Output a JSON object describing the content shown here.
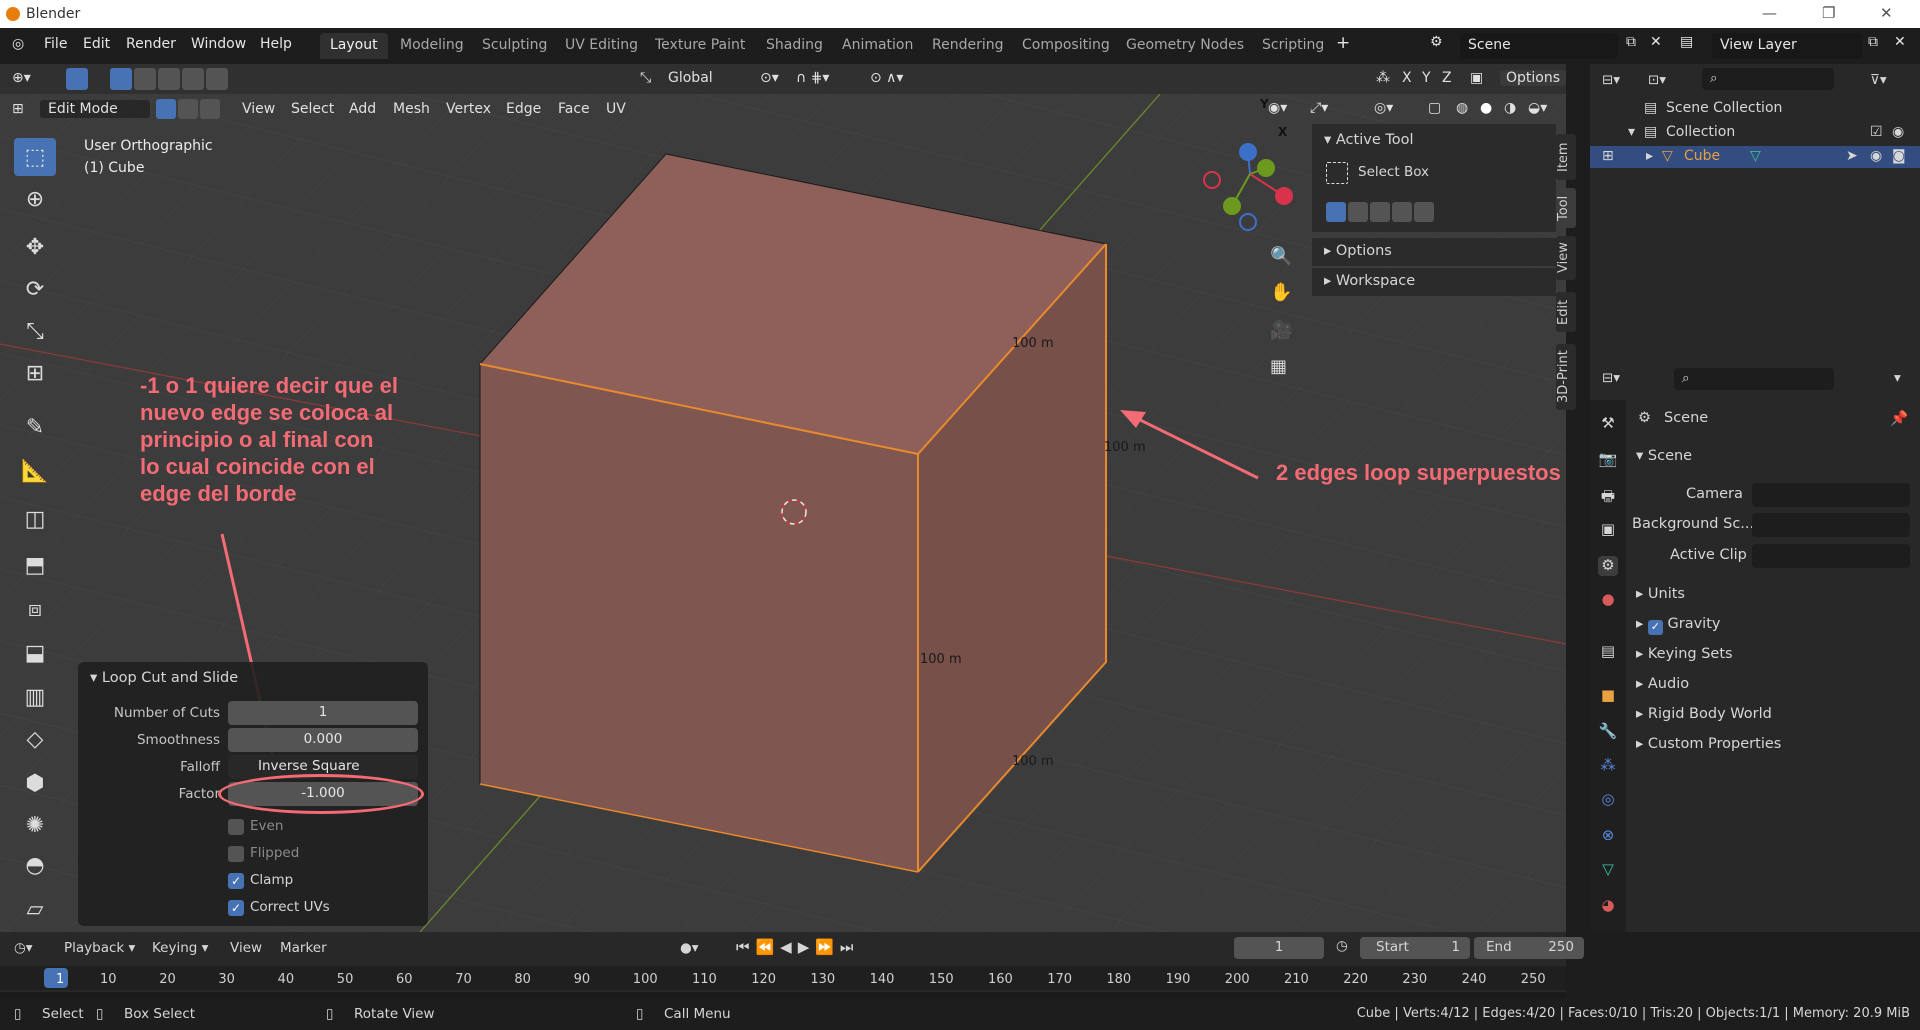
{
  "window": {
    "title": "Blender"
  },
  "menu": [
    "File",
    "Edit",
    "Render",
    "Window",
    "Help"
  ],
  "workspaces": [
    "Layout",
    "Modeling",
    "Sculpting",
    "UV Editing",
    "Texture Paint",
    "Shading",
    "Animation",
    "Rendering",
    "Compositing",
    "Geometry Nodes",
    "Scripting"
  ],
  "scene_name": "Scene",
  "view_layer": "View Layer",
  "viewport": {
    "mode": "Edit Mode",
    "menus": [
      "View",
      "Select",
      "Add",
      "Mesh",
      "Vertex",
      "Edge",
      "Face",
      "UV"
    ],
    "orientation": "Global",
    "axes": [
      "X",
      "Y",
      "Z"
    ],
    "options_label": "Options",
    "info_line1": "User Orthographic",
    "info_line2": "(1) Cube",
    "dims": [
      "100 m",
      "100 m",
      "100 m",
      "100 m"
    ],
    "gizmo": {
      "x": "X",
      "y": "Y",
      "z": "Z"
    }
  },
  "npanel": {
    "active_tool_title": "Active Tool",
    "tool_name": "Select Box",
    "options": "Options",
    "workspace": "Workspace",
    "tabs": [
      "Item",
      "Tool",
      "View",
      "Edit",
      "3D-Print"
    ]
  },
  "loop_panel": {
    "title": "Loop Cut and Slide",
    "number_of_cuts_label": "Number of Cuts",
    "number_of_cuts": "1",
    "smoothness_label": "Smoothness",
    "smoothness": "0.000",
    "falloff_label": "Falloff",
    "falloff": "Inverse Square",
    "factor_label": "Factor",
    "factor": "-1.000",
    "even": "Even",
    "flipped": "Flipped",
    "clamp": "Clamp",
    "correct_uvs": "Correct UVs"
  },
  "annotations": {
    "left_lines": [
      "-1 o 1 quiere decir que el",
      "nuevo edge se coloca al",
      "principio o al final con",
      "lo cual coincide con el",
      "edge del borde"
    ],
    "right": "2 edges loop superpuestos",
    "color": "#f36b74"
  },
  "outliner": {
    "scene_collection": "Scene Collection",
    "collection": "Collection",
    "cube": "Cube"
  },
  "properties": {
    "header": "Scene",
    "section": "Scene",
    "camera": "Camera",
    "background": "Background Sc...",
    "active_clip": "Active Clip",
    "units": "Units",
    "gravity": "Gravity",
    "keying_sets": "Keying Sets",
    "audio": "Audio",
    "rigid_body": "Rigid Body World",
    "custom_props": "Custom Properties"
  },
  "timeline": {
    "playback": "Playback",
    "keying": "Keying",
    "view": "View",
    "marker": "Marker",
    "current_frame": "1",
    "start_label": "Start",
    "start": "1",
    "end_label": "End",
    "end": "250",
    "ticks": [
      "1",
      "10",
      "20",
      "30",
      "40",
      "50",
      "60",
      "70",
      "80",
      "90",
      "100",
      "110",
      "120",
      "130",
      "140",
      "150",
      "160",
      "170",
      "180",
      "190",
      "200",
      "210",
      "220",
      "230",
      "240",
      "250"
    ]
  },
  "status": {
    "select": "Select",
    "box_select": "Box Select",
    "rotate": "Rotate View",
    "call_menu": "Call Menu",
    "stats": "Cube | Verts:4/12 | Edges:4/20 | Faces:0/10 | Tris:20 | Objects:1/1 | Memory: 20.9 MiB"
  },
  "colors": {
    "accent": "#4772b3",
    "cube_fill": "#8a5e58",
    "cube_edge": "#e88a2e"
  }
}
